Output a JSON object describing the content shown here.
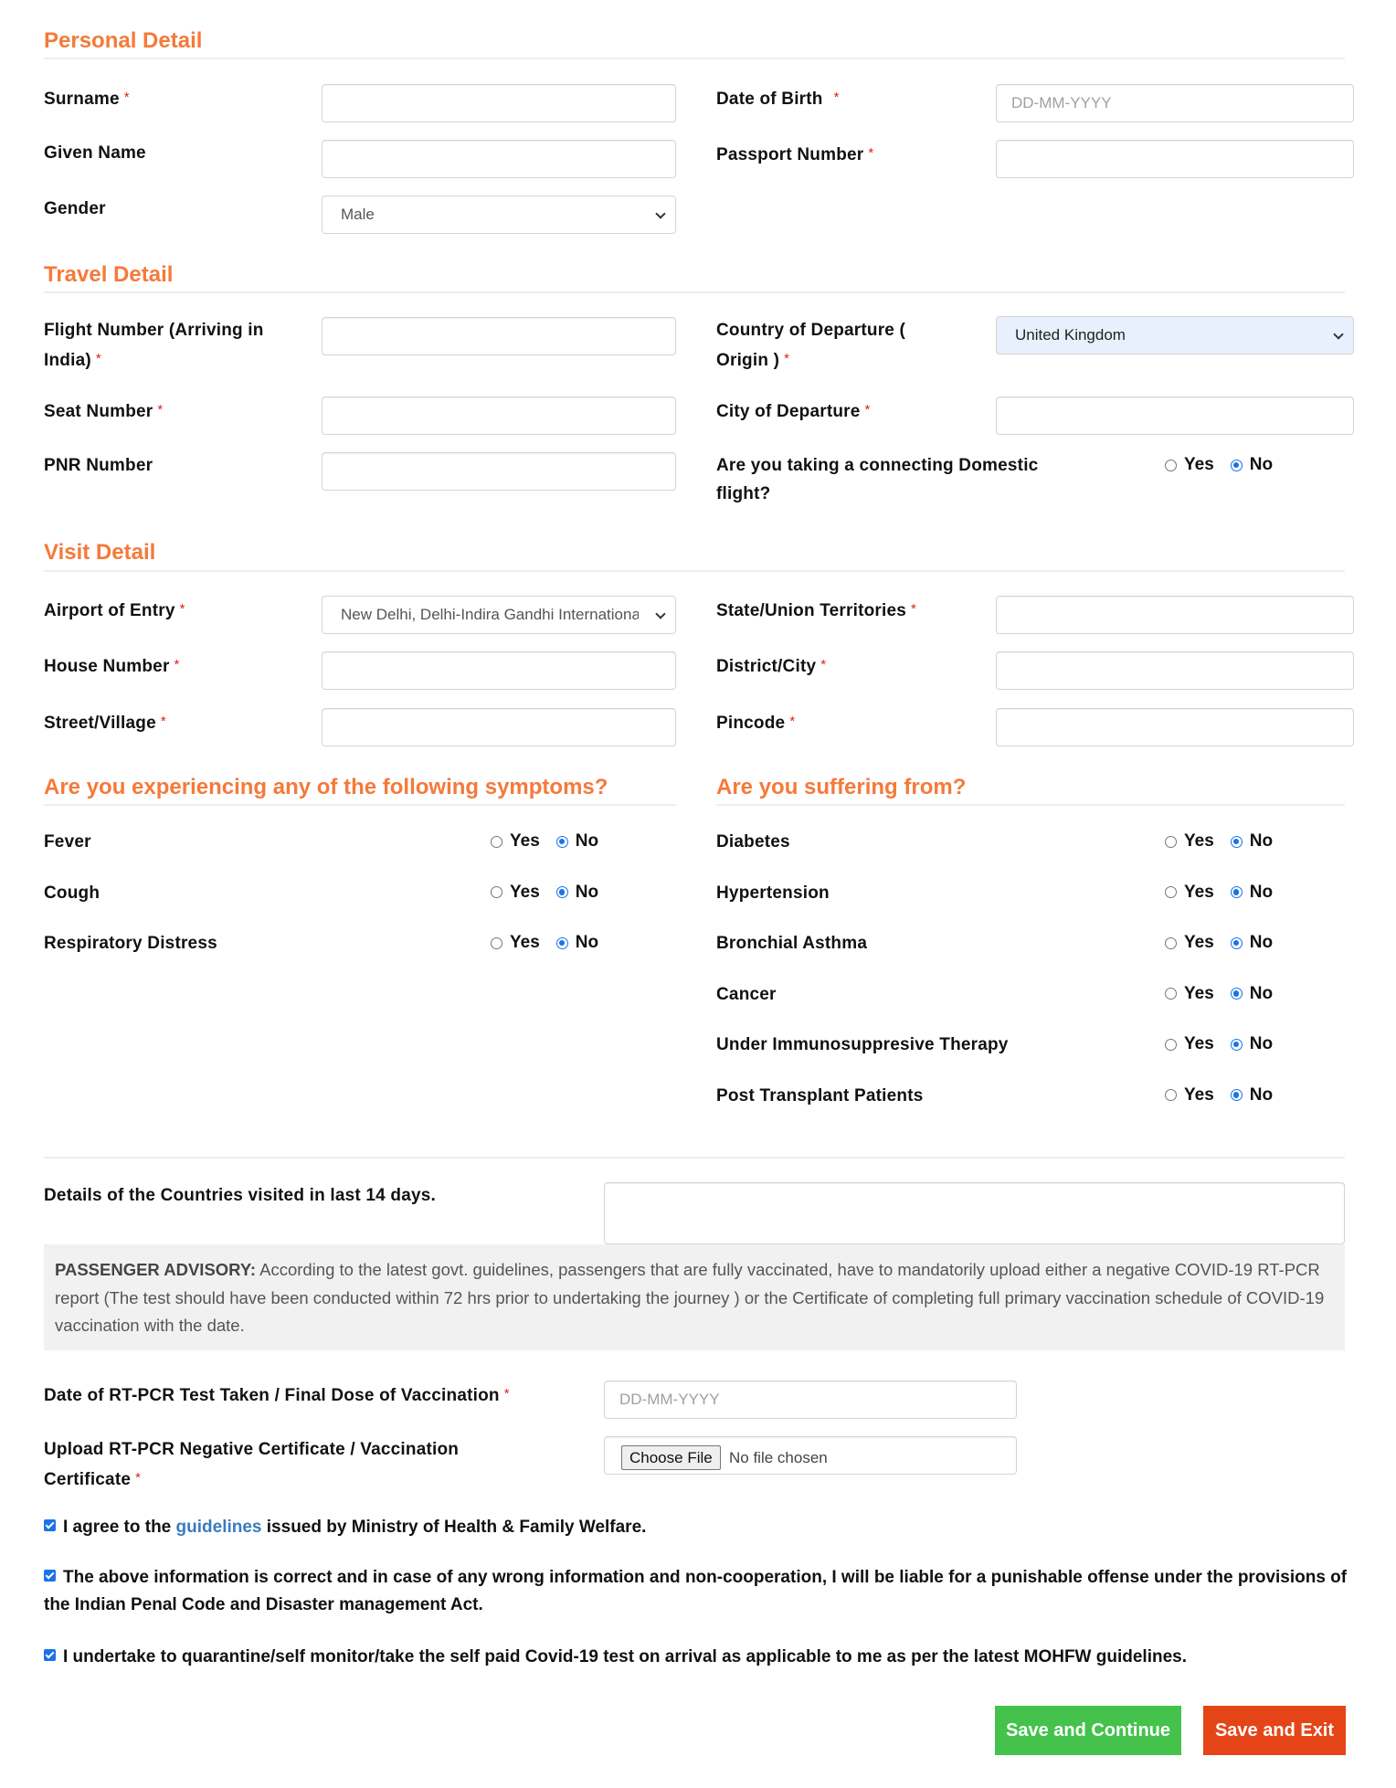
{
  "colors": {
    "section_title": "#f47a3a",
    "required_asterisk": "#e0201b",
    "radio_checked": "#1a73e8",
    "link": "#3a7bbf",
    "save_continue_bg": "#44c24c",
    "save_exit_bg": "#e54516",
    "advisory_bg": "#f1f1f1",
    "autofill_bg": "#e8f0fe"
  },
  "personal": {
    "title": "Personal Detail",
    "surname": {
      "label": "Surname",
      "value": "",
      "required": "*"
    },
    "given_name": {
      "label": "Given Name",
      "value": ""
    },
    "gender": {
      "label": "Gender",
      "selected": "Male"
    },
    "dob": {
      "label": "Date of Birth",
      "placeholder": "DD-MM-YYYY",
      "required": "*"
    },
    "passport": {
      "label": "Passport Number",
      "value": "",
      "required": "*"
    }
  },
  "travel": {
    "title": "Travel Detail",
    "flight": {
      "label_line1": "Flight Number (Arriving in",
      "label_line2": "India)",
      "required": "*",
      "value": ""
    },
    "seat": {
      "label": "Seat Number",
      "required": "*",
      "value": ""
    },
    "pnr": {
      "label": "PNR Number",
      "value": ""
    },
    "country": {
      "label_line1": "Country of Departure (",
      "label_line2": "Origin )",
      "required": "*",
      "selected": "United Kingdom"
    },
    "city": {
      "label": "City of Departure",
      "required": "*",
      "value": ""
    },
    "connecting": {
      "label_line1": "Are you taking a connecting Domestic",
      "label_line2": "flight?",
      "yes": "Yes",
      "no": "No",
      "selected": "No"
    }
  },
  "visit": {
    "title": "Visit Detail",
    "airport": {
      "label": "Airport of Entry",
      "required": "*",
      "selected": "New Delhi, Delhi-Indira Gandhi International Airport"
    },
    "house": {
      "label": "House Number",
      "required": "*",
      "value": ""
    },
    "street": {
      "label": "Street/Village",
      "required": "*",
      "value": ""
    },
    "state": {
      "label": "State/Union Territories",
      "required": "*",
      "value": ""
    },
    "district": {
      "label": "District/City",
      "required": "*",
      "value": ""
    },
    "pincode": {
      "label": "Pincode",
      "required": "*",
      "value": ""
    }
  },
  "symptoms": {
    "title": "Are you experiencing any of the following symptoms?",
    "items": [
      {
        "label": "Fever",
        "yes": "Yes",
        "no": "No",
        "selected": "No"
      },
      {
        "label": "Cough",
        "yes": "Yes",
        "no": "No",
        "selected": "No"
      },
      {
        "label": "Respiratory Distress",
        "yes": "Yes",
        "no": "No",
        "selected": "No"
      }
    ]
  },
  "conditions": {
    "title": "Are you suffering from?",
    "items": [
      {
        "label": "Diabetes",
        "yes": "Yes",
        "no": "No",
        "selected": "No"
      },
      {
        "label": "Hypertension",
        "yes": "Yes",
        "no": "No",
        "selected": "No"
      },
      {
        "label": "Bronchial Asthma",
        "yes": "Yes",
        "no": "No",
        "selected": "No"
      },
      {
        "label": "Cancer",
        "yes": "Yes",
        "no": "No",
        "selected": "No"
      },
      {
        "label": "Under Immunosuppresive Therapy",
        "yes": "Yes",
        "no": "No",
        "selected": "No"
      },
      {
        "label": "Post Transplant Patients",
        "yes": "Yes",
        "no": "No",
        "selected": "No"
      }
    ]
  },
  "countries_visited": {
    "label": "Details of the Countries visited in last 14 days.",
    "value": ""
  },
  "advisory": {
    "heading": "PASSENGER ADVISORY:",
    "text": " According to the latest govt. guidelines, passengers that are fully vaccinated, have to mandatorily upload either a negative COVID-19 RT-PCR report (The test should have been conducted within 72 hrs prior to undertaking the journey ) or the Certificate of completing full primary vaccination schedule of COVID-19 vaccination with the date."
  },
  "rtpcr_date": {
    "label": "Date of RT-PCR Test Taken / Final Dose of Vaccination",
    "required": "*",
    "placeholder": "DD-MM-YYYY"
  },
  "upload": {
    "label_line1": "Upload RT-PCR Negative Certificate / Vaccination",
    "label_line2": "Certificate",
    "required": "*",
    "button": "Choose File",
    "status": "No file chosen"
  },
  "declarations": {
    "agree_prefix": "I agree to the ",
    "agree_link": "guidelines",
    "agree_suffix": " issued by Ministry of Health & Family Welfare.",
    "agree_checked": true,
    "correct_info": "The above information is correct and in case of any wrong information and non-cooperation, I will be liable for a punishable offense under the provisions of the Indian Penal Code and Disaster management Act.",
    "correct_checked": true,
    "quarantine": "I undertake to quarantine/self monitor/take the self paid Covid-19 test on arrival as applicable to me as per the latest MOHFW guidelines.",
    "quarantine_checked": true
  },
  "actions": {
    "save_continue": "Save and Continue",
    "save_exit": "Save and Exit"
  }
}
